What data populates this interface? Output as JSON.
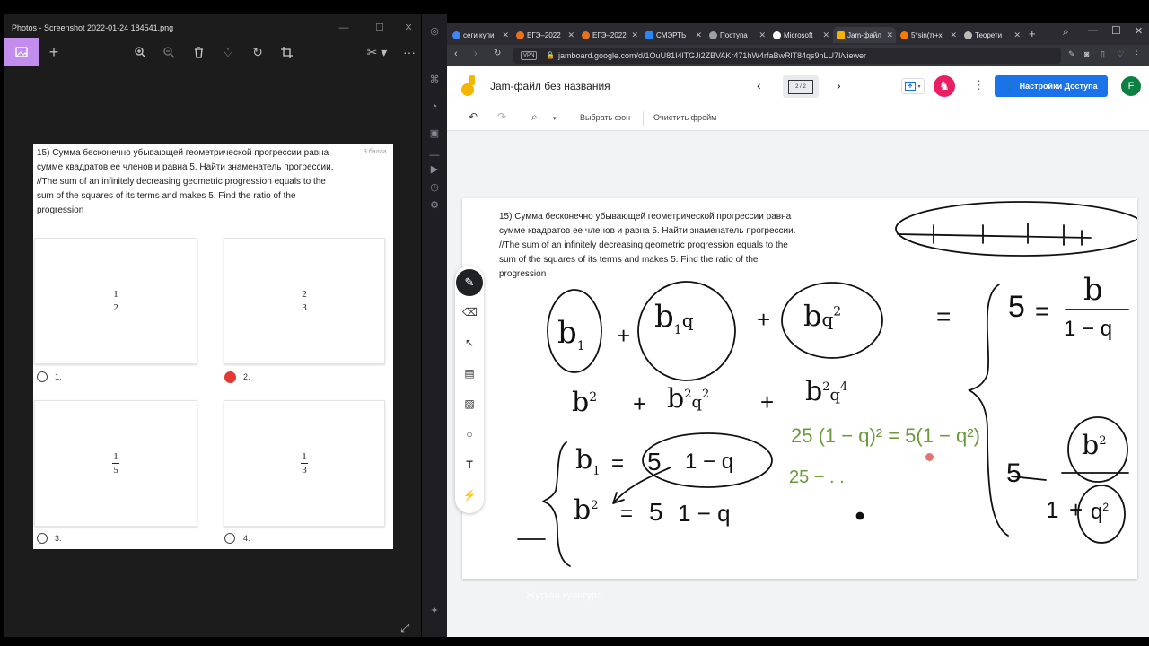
{
  "photos": {
    "title": "Photos - Screenshot 2022-01-24 184541.png",
    "question": {
      "lines": [
        "15) Сумма бесконечно убывающей геометрической прогрессии равна",
        "сумме квадратов ее членов и равна 5. Найти знаменатель прогрессии.",
        "//The sum of an infinitely decreasing geometric progression equals to the",
        "sum of the squares of its terms and makes 5. Find the ratio of the",
        "progression"
      ],
      "points": "3 балла"
    },
    "options": [
      {
        "label": "1.",
        "num": "1",
        "den": "2",
        "selected": false
      },
      {
        "label": "2.",
        "num": "2",
        "den": "3",
        "selected": true
      },
      {
        "label": "3.",
        "num": "1",
        "den": "5",
        "selected": false
      },
      {
        "label": "4.",
        "num": "1",
        "den": "3",
        "selected": false
      }
    ]
  },
  "browser": {
    "tabs": [
      {
        "label": "сеги купи",
        "color": "#4285f4"
      },
      {
        "label": "ЕГЭ–2022",
        "color": "#e8711a"
      },
      {
        "label": "ЕГЭ–2022",
        "color": "#e8711a"
      },
      {
        "label": "СМЭРТЬ",
        "color": "#2787f5"
      },
      {
        "label": "Поступа",
        "color": "#9aa0a6"
      },
      {
        "label": "Microsoft",
        "color": "#ffffff"
      },
      {
        "label": "Jam-файл",
        "color": "#f4b400"
      },
      {
        "label": "5*sin(π+x",
        "color": "#f57c00"
      },
      {
        "label": "Теорети",
        "color": "#bbbbbb"
      }
    ],
    "vpn": "VPN",
    "url": "jamboard.google.com/d/1OuU81I4lTGJi2ZBVAKr471hW4rfaBwRlT84qs9nLU7I/viewer"
  },
  "jamboard": {
    "title": "Jam-файл без названия",
    "frame_counter": "2 / 2",
    "share_label": "Настройки Доступа",
    "avatar": "F",
    "toolbar": {
      "set_bg": "Выбрать фон",
      "clear_frame": "Очистить фрейм"
    },
    "frame_text": [
      "15) Сумма бесконечно убывающей геометрической прогрессии равна",
      "сумме квадратов ее членов и равна 5. Найти знаменатель прогрессии.",
      "//The sum of an infinitely decreasing geometric progression equals to the",
      "sum of the squares of its terms and makes 5. Find the ratio of the",
      "progression"
    ],
    "handwriting": {
      "b1": "b",
      "sub1": "1",
      "plus": "+",
      "q": "q",
      "two": "2",
      "four": "4",
      "eq": "=",
      "five": "5",
      "one_minus_q": "1 − q",
      "green1": "25 (1 − q)² = 5(1 − q²)",
      "green2": "25 − . ."
    }
  },
  "subtitle": "Жуткая культура"
}
